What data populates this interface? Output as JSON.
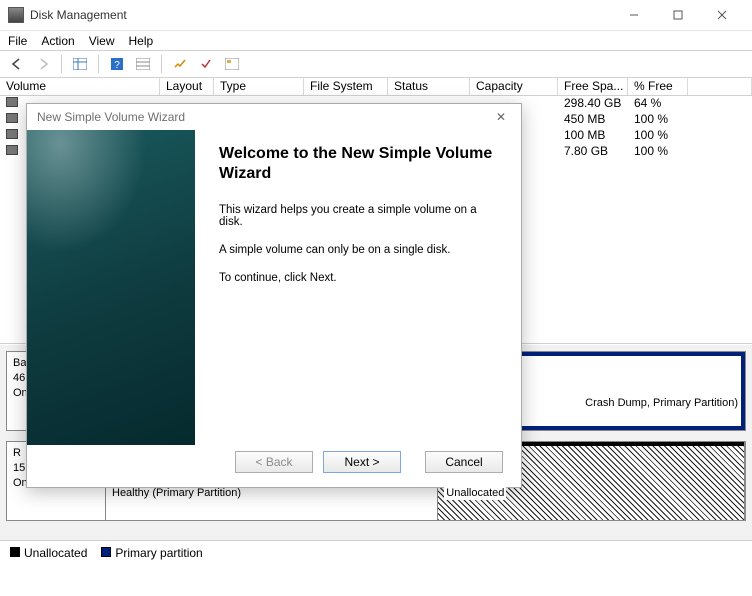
{
  "window": {
    "title": "Disk Management"
  },
  "menu": {
    "file": "File",
    "action": "Action",
    "view": "View",
    "help": "Help"
  },
  "columns": {
    "volume": "Volume",
    "layout": "Layout",
    "type": "Type",
    "fs": "File System",
    "status": "Status",
    "capacity": "Capacity",
    "free": "Free Spa...",
    "pct": "% Free"
  },
  "rows": [
    {
      "free": "298.40 GB",
      "pct": "64 %"
    },
    {
      "free": "450 MB",
      "pct": "100 %"
    },
    {
      "free": "100 MB",
      "pct": "100 %"
    },
    {
      "free": "7.80 GB",
      "pct": "100 %"
    }
  ],
  "disk0": {
    "head_l1": "Ba",
    "head_l2": "46",
    "head_l3": "On",
    "right_label": "Crash Dump, Primary Partition)"
  },
  "disk1": {
    "head_l1": "R",
    "head_l2": "15",
    "head_l3": "Online",
    "part_a": "Healthy (Primary Partition)",
    "part_b": "Unallocated"
  },
  "legend": {
    "unalloc": "Unallocated",
    "primary": "Primary partition"
  },
  "wizard": {
    "title": "New Simple Volume Wizard",
    "heading": "Welcome to the New Simple Volume Wizard",
    "p1": "This wizard helps you create a simple volume on a disk.",
    "p2": "A simple volume can only be on a single disk.",
    "p3": "To continue, click Next.",
    "back": "< Back",
    "next": "Next >",
    "cancel": "Cancel"
  }
}
